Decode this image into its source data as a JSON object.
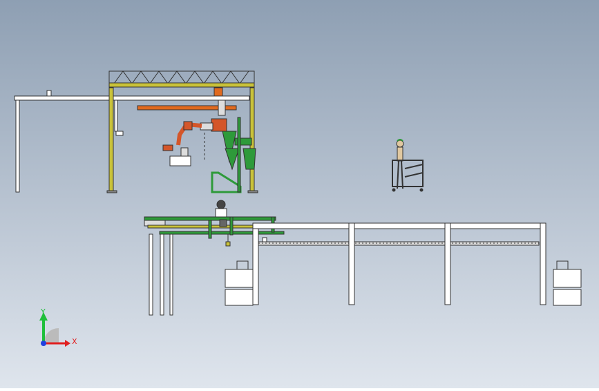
{
  "triad": {
    "y_label": "Y",
    "x_label": "X"
  },
  "colors": {
    "background_top": "#8e9fb3",
    "background_bottom": "#dfe5ed",
    "steel_outline": "#333333",
    "frame_fill": "#ffffff",
    "gantry_yellow": "#c9c23a",
    "rail_orange": "#e06a1f",
    "robot_orange": "#d4562a",
    "fixture_green": "#2e9a3a",
    "axis_green": "#1fbf3a",
    "axis_red": "#e02020",
    "axis_blue": "#2040e0"
  }
}
